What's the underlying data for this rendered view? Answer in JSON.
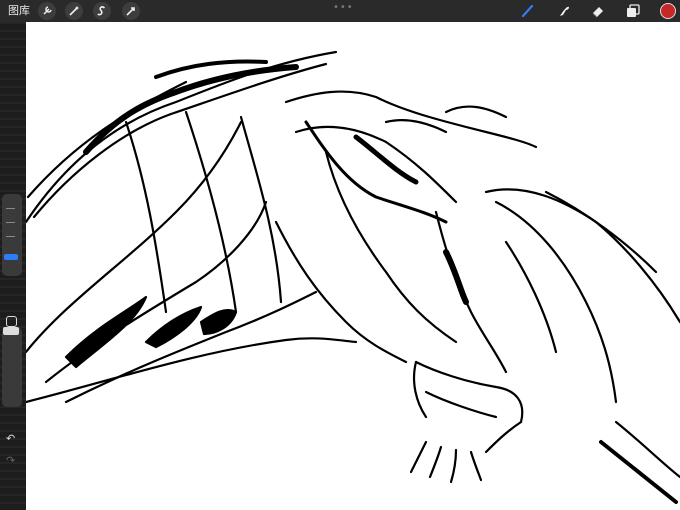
{
  "topbar": {
    "gallery_label": "图库",
    "tools": [
      "wrench-icon",
      "magic-wand-icon",
      "selection-icon",
      "transform-icon"
    ],
    "right_tools": [
      "brush-icon",
      "smudge-icon",
      "eraser-icon",
      "layers-icon"
    ],
    "active_tool": "brush",
    "accent_color": "#2f7df6",
    "current_color": "#c62828"
  },
  "sidebar": {
    "brush_size_controls": [
      "size-slider",
      "opacity-slider"
    ],
    "undo_glyph": "↶",
    "redo_glyph": "↷"
  }
}
